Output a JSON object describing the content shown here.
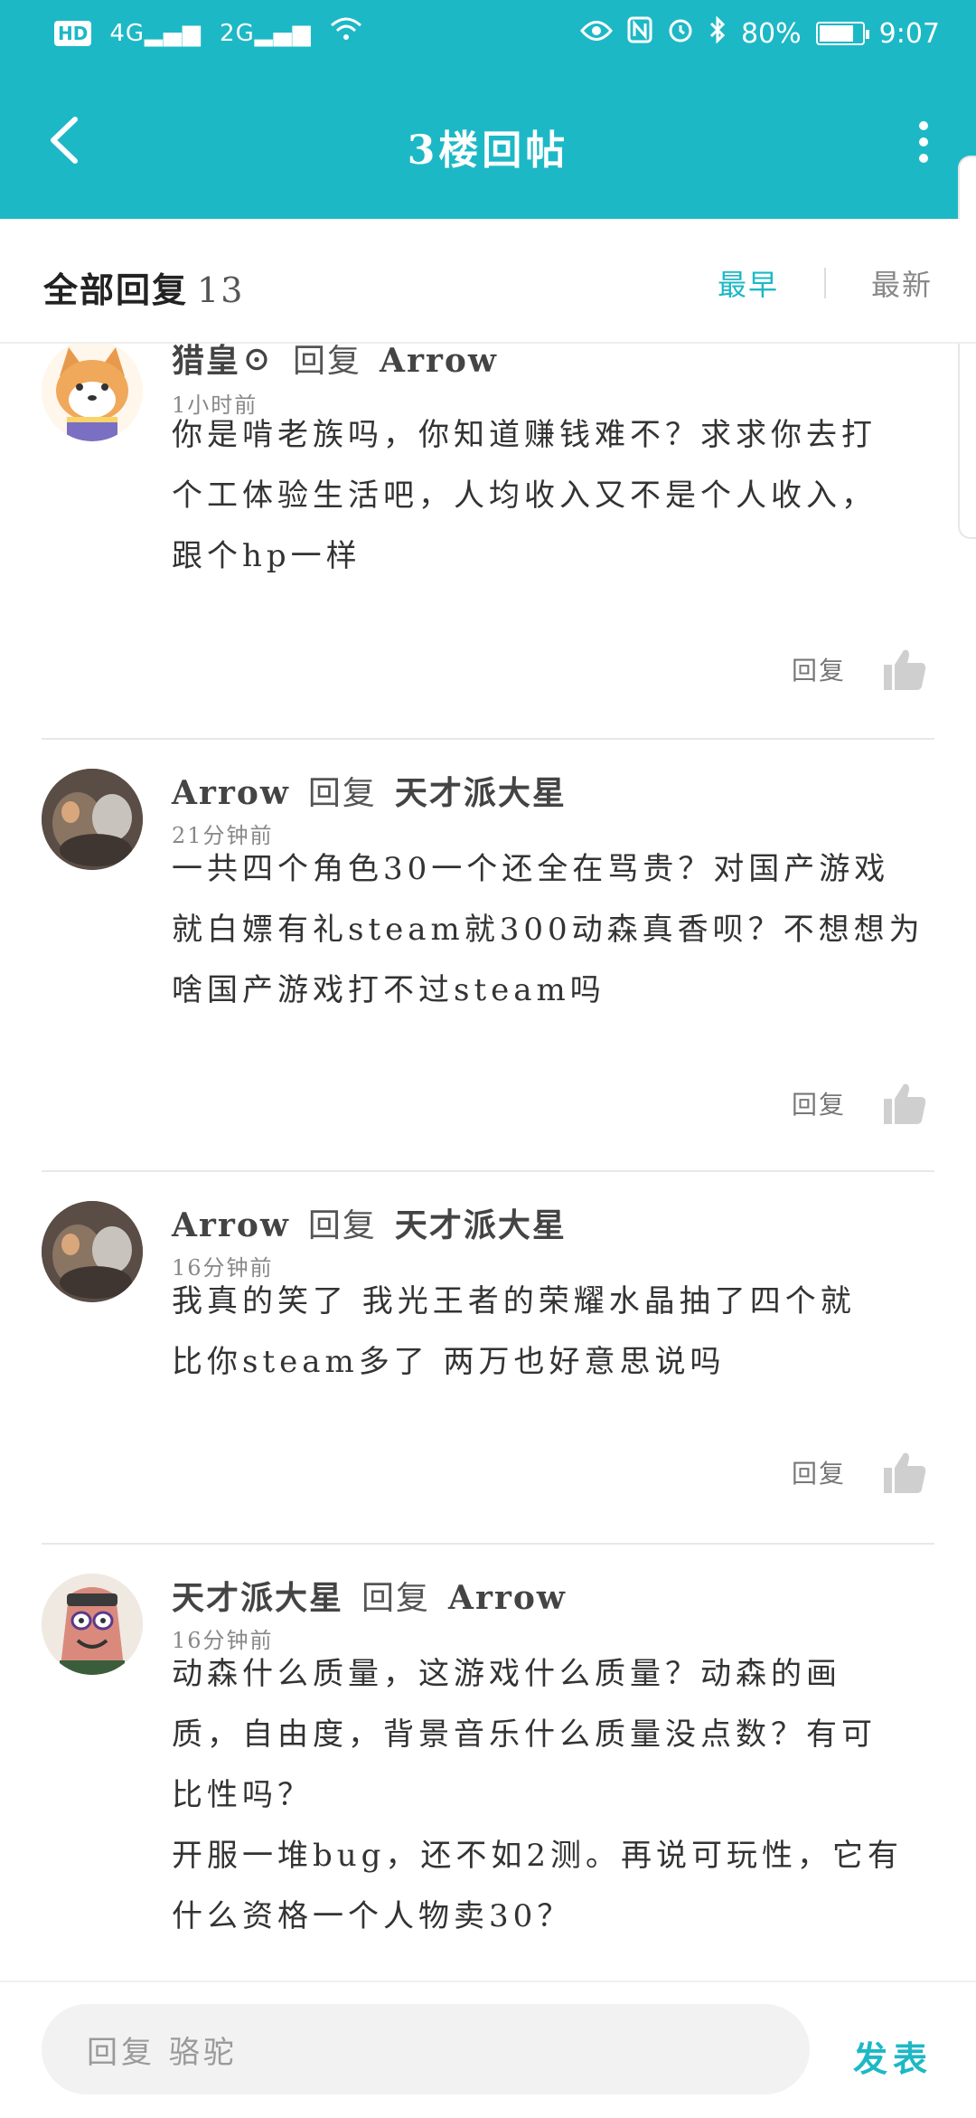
{
  "status": {
    "hd": "HD",
    "sim1": "4G",
    "sim2": "2G",
    "battery_pct": "80%",
    "battery_level": 0.8,
    "time": "9:07"
  },
  "header": {
    "title": "3楼回帖"
  },
  "subheader": {
    "all_label": "全部回复",
    "count": "13",
    "sort_earliest": "最早",
    "sort_newest": "最新"
  },
  "replies": [
    {
      "user": "猎皇☉",
      "verb": "回复",
      "target": "Arrow",
      "time": "1小时前",
      "lines": [
        "你是啃老族吗，你知道赚钱难不？求求你去打",
        "个工体验生活吧，人均收入又不是个人收入，",
        "跟个hp一样"
      ],
      "reply_label": "回复"
    },
    {
      "user": "Arrow",
      "verb": "回复",
      "target": "天才派大星",
      "time": "21分钟前",
      "lines": [
        "一共四个角色30一个还全在骂贵？对国产游戏",
        "就白嫖有礼steam就300动森真香呗？不想想为",
        "啥国产游戏打不过steam吗"
      ],
      "reply_label": "回复"
    },
    {
      "user": "Arrow",
      "verb": "回复",
      "target": "天才派大星",
      "time": "16分钟前",
      "lines": [
        "我真的笑了 我光王者的荣耀水晶抽了四个就",
        "比你steam多了 两万也好意思说吗"
      ],
      "reply_label": "回复"
    },
    {
      "user": "天才派大星",
      "verb": "回复",
      "target": "Arrow",
      "time": "16分钟前",
      "lines": [
        "动森什么质量，这游戏什么质量？动森的画",
        "质，自由度，背景音乐什么质量没点数？有可",
        "比性吗？",
        "开服一堆bug，还不如2测。再说可玩性，它有",
        "什么资格一个人物卖30？"
      ],
      "reply_label": "回复"
    }
  ],
  "composer": {
    "placeholder": "回复 骆驼",
    "publish": "发表"
  },
  "colors": {
    "accent": "#1db8c6"
  }
}
